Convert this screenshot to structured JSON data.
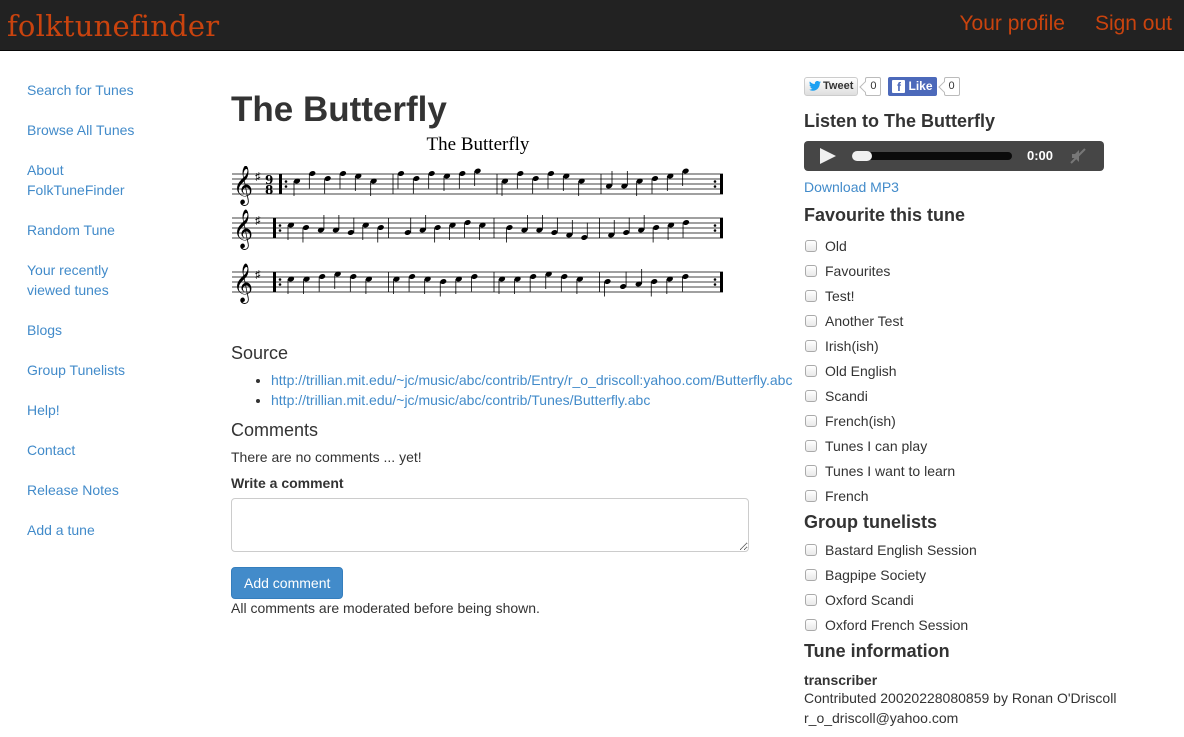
{
  "header": {
    "brand": "folktunefinder",
    "links": [
      "Your profile",
      "Sign out"
    ],
    "brand_color": "#c9430e",
    "bg_color": "#222222"
  },
  "sidebar": {
    "items": [
      {
        "label": "Search for Tunes"
      },
      {
        "label": "Browse All Tunes"
      },
      {
        "label": "About FolkTuneFinder"
      },
      {
        "label": "Random Tune"
      },
      {
        "label": "Your recently viewed tunes"
      },
      {
        "label": "Blogs"
      },
      {
        "label": "Group Tunelists"
      },
      {
        "label": "Help!"
      },
      {
        "label": "Contact"
      },
      {
        "label": "Release Notes"
      },
      {
        "label": "Add a tune"
      }
    ]
  },
  "main": {
    "title": "The Butterfly",
    "sheet_music": {
      "title": "The Butterfly",
      "key_signature": "G major (one sharp)",
      "time_signature": "9/8",
      "staves": 3
    },
    "source_heading": "Source",
    "sources": [
      "http://trillian.mit.edu/~jc/music/abc/contrib/Entry/r_o_driscoll:yahoo.com/Butterfly.abc",
      "http://trillian.mit.edu/~jc/music/abc/contrib/Tunes/Butterfly.abc"
    ],
    "comments_heading": "Comments",
    "no_comments": "There are no comments ... yet!",
    "write_label": "Write a comment",
    "comment_value": "",
    "add_button": "Add comment",
    "moderated_note": "All comments are moderated before being shown."
  },
  "right": {
    "social": {
      "tweet_label": "Tweet",
      "tweet_count": "0",
      "like_label": "Like",
      "like_count": "0"
    },
    "listen_heading": "Listen to The Butterfly",
    "player": {
      "time": "0:00",
      "progress": 0,
      "muted": true
    },
    "download_label": "Download MP3",
    "favourite_heading": "Favourite this tune",
    "favourites": [
      {
        "label": "Old",
        "checked": false
      },
      {
        "label": "Favourites",
        "checked": false
      },
      {
        "label": "Test!",
        "checked": false
      },
      {
        "label": "Another Test",
        "checked": false
      },
      {
        "label": "Irish(ish)",
        "checked": false
      },
      {
        "label": "Old English",
        "checked": false
      },
      {
        "label": "Scandi",
        "checked": false
      },
      {
        "label": "French(ish)",
        "checked": false
      },
      {
        "label": "Tunes I can play",
        "checked": false
      },
      {
        "label": "Tunes I want to learn",
        "checked": false
      },
      {
        "label": "French",
        "checked": false
      }
    ],
    "group_heading": "Group tunelists",
    "groups": [
      {
        "label": "Bastard English Session",
        "checked": false
      },
      {
        "label": "Bagpipe Society",
        "checked": false
      },
      {
        "label": "Oxford Scandi",
        "checked": false
      },
      {
        "label": "Oxford French Session",
        "checked": false
      }
    ],
    "info_heading": "Tune information",
    "info_label": "transcriber",
    "info_lines": [
      "Contributed 20020228080859 by Ronan O'Driscoll",
      "r_o_driscoll@yahoo.com"
    ]
  }
}
